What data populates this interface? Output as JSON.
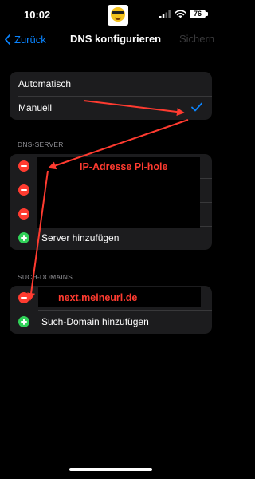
{
  "status_bar": {
    "time": "10:02",
    "battery": "76",
    "app_icon": "sunglasses-emoji-icon"
  },
  "nav": {
    "back_label": "Zurück",
    "title": "DNS konfigurieren",
    "save_label": "Sichern"
  },
  "mode": {
    "options": [
      {
        "label": "Automatisch",
        "selected": false
      },
      {
        "label": "Manuell",
        "selected": true
      }
    ]
  },
  "dns_section": {
    "header": "DNS-SERVER",
    "server_rows": 3,
    "add_label": "Server hinzufügen"
  },
  "search_section": {
    "header": "SUCH-DOMAINS",
    "add_label": "Such-Domain hinzufügen"
  },
  "annotations": {
    "pihole_label": "IP-Adresse Pi-hole",
    "domain_label": "next.meineurl.de",
    "color": "#ff3b30"
  },
  "colors": {
    "accent": "#0a84ff",
    "delete": "#ff3b30",
    "add": "#30d158",
    "group_bg": "#1c1c1e"
  }
}
